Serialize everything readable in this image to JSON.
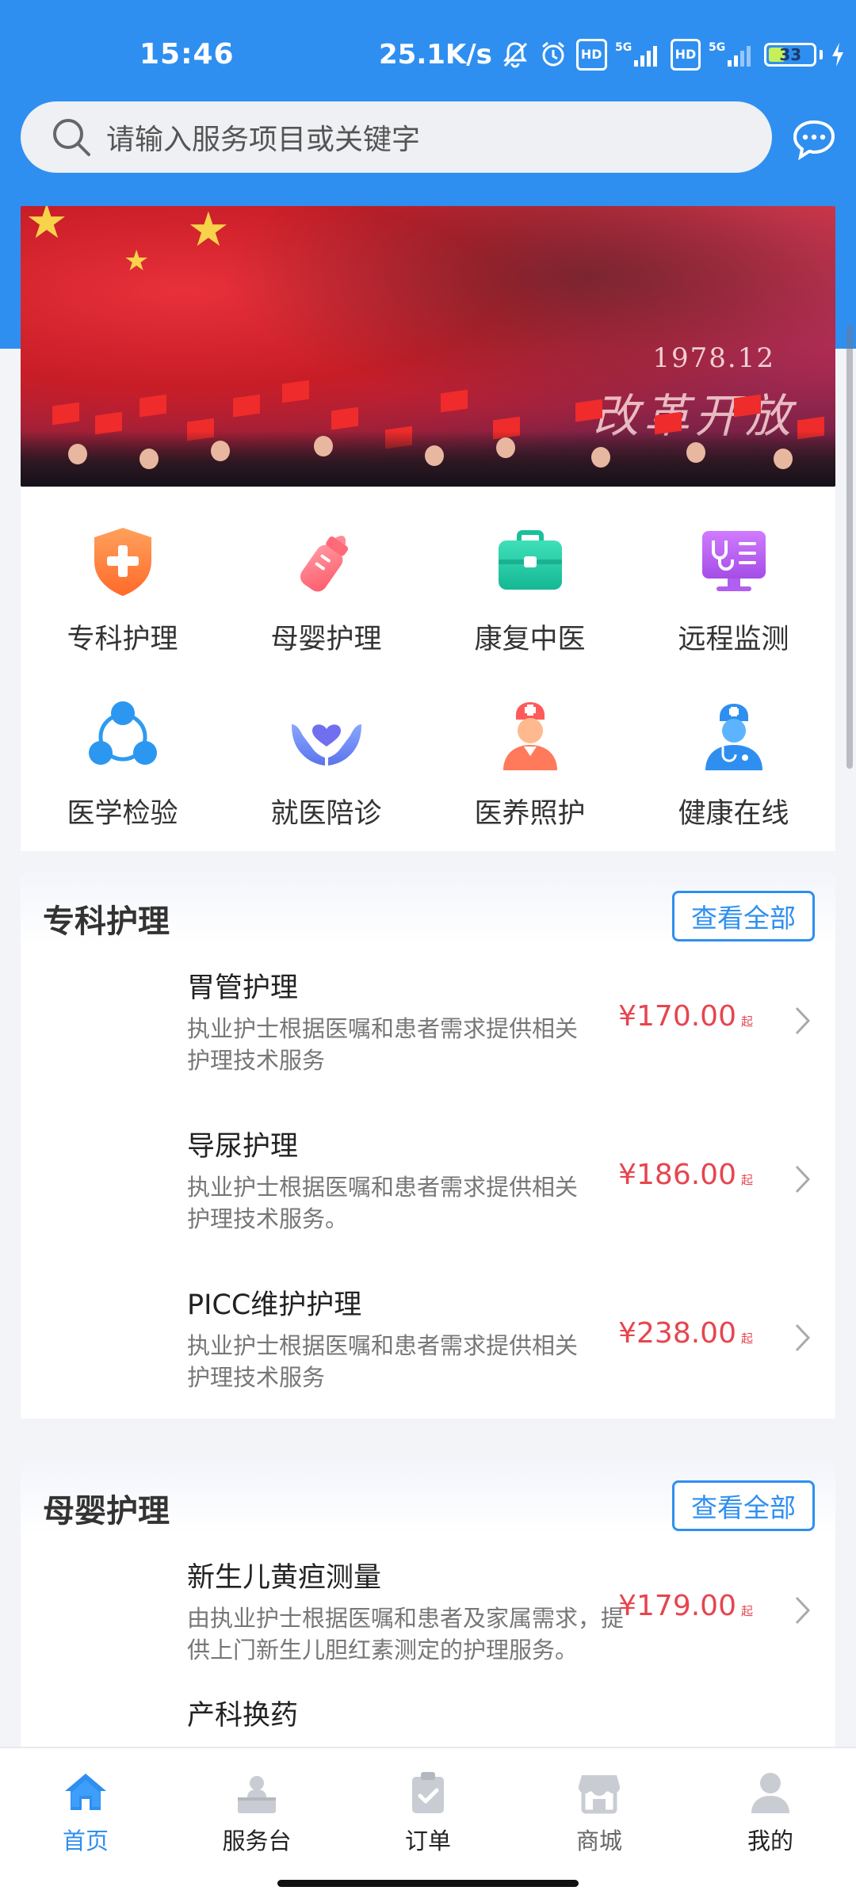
{
  "status_bar": {
    "time": "15:46",
    "net_speed": "25.1K/s",
    "hd_label": "HD",
    "signal_label": "5G",
    "battery": "33"
  },
  "search": {
    "placeholder": "请输入服务项目或关键字"
  },
  "banner": {
    "year_text": "1978.12",
    "slogan": "改革开放"
  },
  "categories": [
    {
      "label": "专科护理",
      "icon": "shield-plus-icon",
      "color": "#ff7b3a"
    },
    {
      "label": "母婴护理",
      "icon": "baby-bottle-icon",
      "color": "#ff6a6a"
    },
    {
      "label": "康复中医",
      "icon": "medical-kit-icon",
      "color": "#21c9a4"
    },
    {
      "label": "远程监测",
      "icon": "monitor-stethoscope-icon",
      "color": "#b85ff0"
    },
    {
      "label": "医学检验",
      "icon": "network-circles-icon",
      "color": "#2f9bf0"
    },
    {
      "label": "就医陪诊",
      "icon": "heart-hands-icon",
      "color": "#6d8cf2"
    },
    {
      "label": "医养照护",
      "icon": "nurse-icon",
      "color": "#ff6f5a"
    },
    {
      "label": "健康在线",
      "icon": "doctor-icon",
      "color": "#2f9bf0"
    }
  ],
  "sections": [
    {
      "title": "专科护理",
      "view_all": "查看全部",
      "items": [
        {
          "name": "胃管护理",
          "desc": "执业护士根据医嘱和患者需求提供相关护理技术服务",
          "price": "¥170.00",
          "suffix": "起"
        },
        {
          "name": "导尿护理",
          "desc": "执业护士根据医嘱和患者需求提供相关护理技术服务。",
          "price": "¥186.00",
          "suffix": "起"
        },
        {
          "name": "PICC维护护理",
          "desc": "执业护士根据医嘱和患者需求提供相关护理技术服务",
          "price": "¥238.00",
          "suffix": "起"
        }
      ]
    },
    {
      "title": "母婴护理",
      "view_all": "查看全部",
      "items": [
        {
          "name": "新生儿黄疸测量",
          "desc": "由执业护士根据医嘱和患者及家属需求，提供上门新生儿胆红素测定的护理服务。",
          "price": "¥179.00",
          "suffix": "起"
        },
        {
          "name": "产科换药",
          "desc": "",
          "price": "",
          "suffix": ""
        }
      ]
    }
  ],
  "bottom_nav": [
    {
      "label": "首页",
      "icon": "home-icon",
      "active": true
    },
    {
      "label": "服务台",
      "icon": "service-desk-icon",
      "active": false
    },
    {
      "label": "订单",
      "icon": "order-clipboard-icon",
      "active": false
    },
    {
      "label": "商城",
      "icon": "store-icon",
      "active": false
    },
    {
      "label": "我的",
      "icon": "profile-icon",
      "active": false
    }
  ],
  "colors": {
    "primary": "#2f8ff0",
    "price": "#e6454f",
    "background": "#f3f4f8"
  }
}
